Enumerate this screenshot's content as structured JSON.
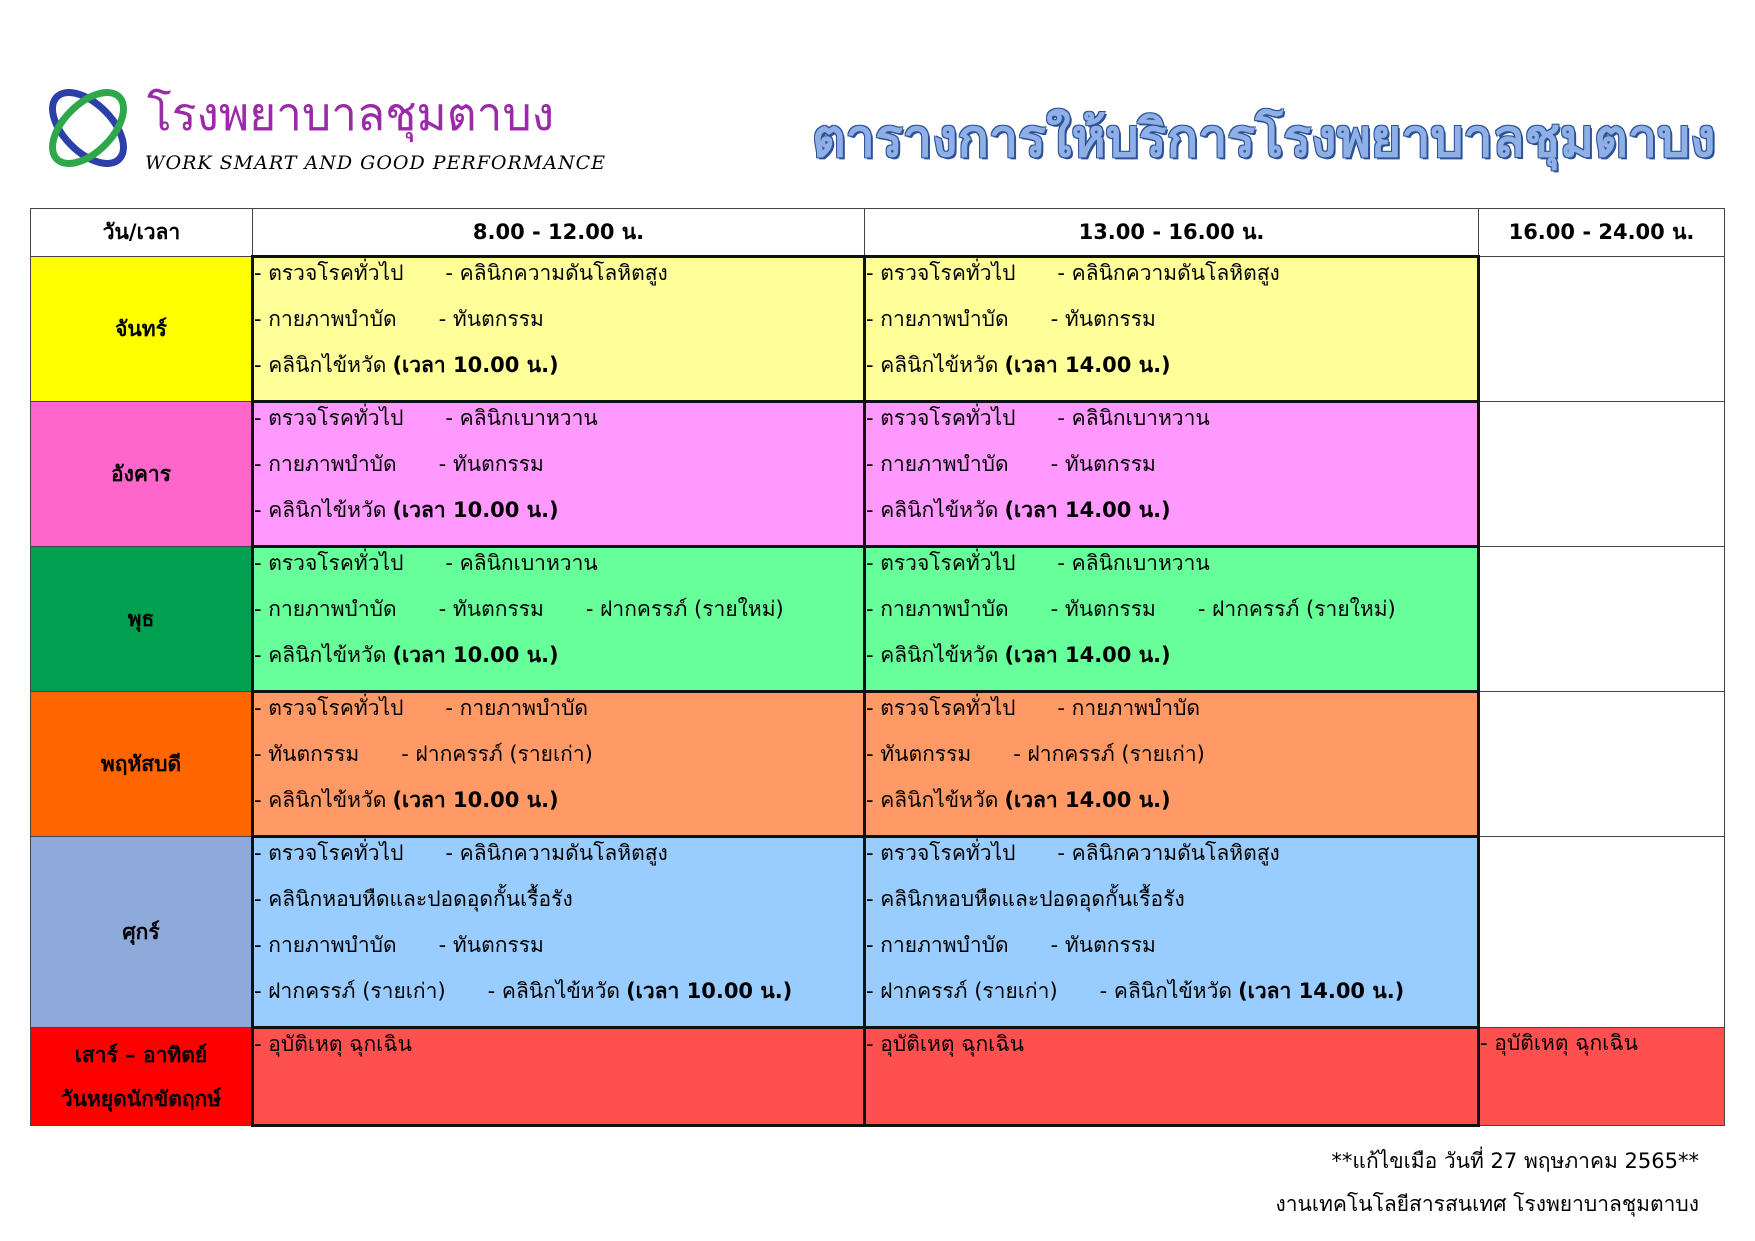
{
  "header": {
    "hospital_name": "โรงพยาบาลชุมตาบง",
    "slogan": "WORK SMART AND GOOD PERFORMANCE",
    "title": "ตารางการให้บริการโรงพยาบาลชุมตาบง"
  },
  "table": {
    "headers": [
      "วัน/เวลา",
      "8.00 - 12.00 น.",
      "13.00 - 16.00 น.",
      "16.00 - 24.00 น."
    ],
    "rows": [
      {
        "day": "จันทร์",
        "color": "#ffff00",
        "cell_color": "#ffff99",
        "am": [
          [
            "- ตรวจโรคทั่วไป",
            "- คลินิกความดันโลหิตสูง"
          ],
          [
            "- กายภาพบำบัด",
            "- ทันตกรรม"
          ],
          [
            "- คลินิกไข้หวัด",
            "(เวลา 10.00 น.)"
          ]
        ],
        "pm": [
          [
            "- ตรวจโรคทั่วไป",
            "- คลินิกความดันโลหิตสูง"
          ],
          [
            "- กายภาพบำบัด",
            "- ทันตกรรม"
          ],
          [
            "- คลินิกไข้หวัด",
            "(เวลา 14.00 น.)"
          ]
        ],
        "eve": ""
      },
      {
        "day": "อังคาร",
        "color": "#ff66cc",
        "cell_color": "#ff99ff",
        "am": [
          [
            "- ตรวจโรคทั่วไป",
            "- คลินิกเบาหวาน"
          ],
          [
            "- กายภาพบำบัด",
            "- ทันตกรรม"
          ],
          [
            "- คลินิกไข้หวัด",
            "(เวลา 10.00 น.)"
          ]
        ],
        "pm": [
          [
            "- ตรวจโรคทั่วไป",
            "- คลินิกเบาหวาน"
          ],
          [
            "- กายภาพบำบัด",
            "- ทันตกรรม"
          ],
          [
            "- คลินิกไข้หวัด",
            "(เวลา 14.00 น.)"
          ]
        ],
        "eve": ""
      },
      {
        "day": "พุธ",
        "color": "#00a050",
        "cell_color": "#66ff99",
        "am": [
          [
            "- ตรวจโรคทั่วไป",
            "- คลินิกเบาหวาน"
          ],
          [
            "- กายภาพบำบัด",
            "- ทันตกรรม",
            "- ฝากครรภ์ (รายใหม่)"
          ],
          [
            "- คลินิกไข้หวัด",
            "(เวลา 10.00 น.)"
          ]
        ],
        "pm": [
          [
            "- ตรวจโรคทั่วไป",
            "- คลินิกเบาหวาน"
          ],
          [
            "- กายภาพบำบัด",
            "- ทันตกรรม",
            "- ฝากครรภ์ (รายใหม่)"
          ],
          [
            "- คลินิกไข้หวัด",
            "(เวลา 14.00 น.)"
          ]
        ],
        "eve": ""
      },
      {
        "day": "พฤหัสบดี",
        "color": "#ff6600",
        "cell_color": "#ff9966",
        "am": [
          [
            "- ตรวจโรคทั่วไป",
            "- กายภาพบำบัด"
          ],
          [
            "- ทันตกรรม",
            "- ฝากครรภ์ (รายเก่า)"
          ],
          [
            "- คลินิกไข้หวัด",
            "(เวลา 10.00 น.)"
          ]
        ],
        "pm": [
          [
            "- ตรวจโรคทั่วไป",
            "- กายภาพบำบัด"
          ],
          [
            "- ทันตกรรม",
            "- ฝากครรภ์ (รายเก่า)"
          ],
          [
            "- คลินิกไข้หวัด",
            "(เวลา 14.00 น.)"
          ]
        ],
        "eve": ""
      },
      {
        "day": "ศุกร์",
        "color": "#8eaadb",
        "cell_color": "#99ccff",
        "am": [
          [
            "- ตรวจโรคทั่วไป",
            "- คลินิกความดันโลหิตสูง"
          ],
          [
            "- คลินิกหอบหืดและปอดอุดกั้นเรื้อรัง"
          ],
          [
            "- กายภาพบำบัด",
            "- ทันตกรรม"
          ],
          [
            "- ฝากครรภ์ (รายเก่า)",
            "- คลินิกไข้หวัด",
            "(เวลา 10.00 น.)"
          ]
        ],
        "pm": [
          [
            "- ตรวจโรคทั่วไป",
            "- คลินิกความดันโลหิตสูง"
          ],
          [
            "- คลินิกหอบหืดและปอดอุดกั้นเรื้อรัง"
          ],
          [
            "- กายภาพบำบัด",
            "- ทันตกรรม"
          ],
          [
            "- ฝากครรภ์ (รายเก่า)",
            "- คลินิกไข้หวัด",
            "(เวลา 14.00 น.)"
          ]
        ],
        "eve": ""
      },
      {
        "day": "เสาร์ – อาทิตย์\nวันหยุดนักขัตฤกษ์",
        "color": "#ff0000",
        "cell_color": "#ff5050",
        "am": [
          [
            "- อุบัติเหตุ ฉุกเฉิน"
          ]
        ],
        "pm": [
          [
            "- อุบัติเหตุ ฉุกเฉิน"
          ]
        ],
        "eve": "- อุบัติเหตุ ฉุกเฉิน",
        "eve_color": "#ff5050"
      }
    ]
  },
  "footer": {
    "revision": "**แก้ไขเมือ วันที่ 27 พฤษภาคม 2565**",
    "department": "งานเทคโนโลยีสารสนเทศ โรงพยาบาลชุมตาบง"
  },
  "colors": {
    "brand_purple": "#9a2aa8",
    "title_blue": "#8fb0e6",
    "logo_blue": "#2d3fa8",
    "logo_green": "#2ea84a"
  },
  "icons": [
    "hospital-logo-icon"
  ]
}
